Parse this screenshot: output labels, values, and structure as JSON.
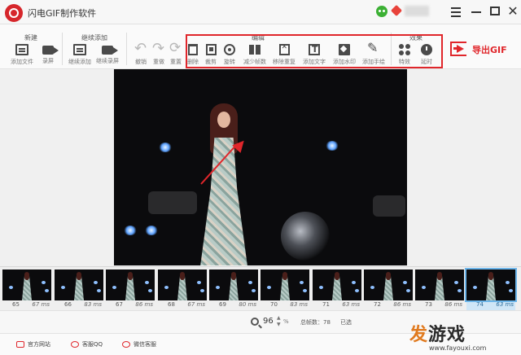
{
  "app": {
    "title": "闪电GIF制作软件"
  },
  "toolbar": {
    "groups": {
      "new": "新建",
      "continue": "继续添加",
      "edit": "编辑",
      "effects": "效果"
    },
    "tools": {
      "add_file": "添加文件",
      "record": "录屏",
      "continue_add": "继续添加",
      "continue_record": "继续录屏",
      "undo": "撤销",
      "redo": "重做",
      "reset": "重置",
      "delete": "删除",
      "crop": "裁剪",
      "rotate": "旋转",
      "reduce_frames": "减少帧数",
      "remove_duplicate": "移除重复",
      "add_text": "添加文字",
      "add_watermark": "添加水印",
      "add_handwriting": "添加手绘",
      "effects": "特效",
      "delay": "延时"
    },
    "export_label": "导出GIF"
  },
  "filmstrip": {
    "frames": [
      {
        "num": "65",
        "ms": "67 ms"
      },
      {
        "num": "66",
        "ms": "83 ms"
      },
      {
        "num": "67",
        "ms": "86 ms"
      },
      {
        "num": "68",
        "ms": "67 ms"
      },
      {
        "num": "69",
        "ms": "80 ms"
      },
      {
        "num": "70",
        "ms": "83 ms"
      },
      {
        "num": "71",
        "ms": "63 ms"
      },
      {
        "num": "72",
        "ms": "86 ms"
      },
      {
        "num": "73",
        "ms": "86 ms"
      },
      {
        "num": "74",
        "ms": "63 ms"
      }
    ],
    "selected_frame": "74"
  },
  "status": {
    "zoom_value": "96",
    "zoom_unit": "%",
    "total_frames": "总帧数：78",
    "selected_label": "已选"
  },
  "footer": {
    "website": "官方网站",
    "qq_support": "客服QQ",
    "wechat_support": "微信客服"
  },
  "watermark": {
    "logo_fa": "发",
    "logo_youxi": "游戏",
    "url": "www.fayouxi.com"
  },
  "colors": {
    "accent_red": "#e0262b",
    "selected_blue": "#6cb5ea"
  }
}
